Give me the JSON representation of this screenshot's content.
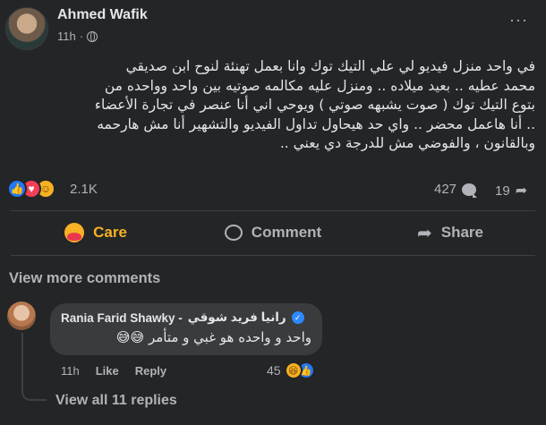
{
  "post": {
    "author": "Ahmed Wafik",
    "time": "11h",
    "more_label": "···",
    "text_lines": [
      "في واحد منزل فيديو لي علي التيك توك وانا بعمل تهنئة لنوح ابن صديقي",
      "محمد عطيه .. بعيد ميلاده .. ومنزل عليه مكالمه صوتيه بين واحد وواحده من",
      "بتوع التيك توك ( صوت يشبهه صوتي ) ويوحي اني أنا عنصر في تجارة الأعضاء",
      ".. أنا هاعمل محضر .. واي حد هيحاول تداول الفيديو والتشهير أنا مش هارحمه",
      "وبالقانون ، والفوضي مش للدرجة دي يعني .."
    ]
  },
  "stats": {
    "reactions": "2.1K",
    "comments": "427",
    "shares": "19"
  },
  "actions": {
    "care": "Care",
    "comment": "Comment",
    "share": "Share"
  },
  "comments": {
    "view_more": "View more comments",
    "items": [
      {
        "author_ar": "رانيا فريد شوقي",
        "author_en": "Rania Farid Shawky -",
        "text": "واحد و واحده هو غبي و متأمر 😅😅",
        "time": "11h",
        "like_label": "Like",
        "reply_label": "Reply",
        "reaction_count": "45"
      }
    ],
    "view_all_replies": "View all 11 replies"
  },
  "colors": {
    "background": "#242526",
    "bubble": "#3a3b3c",
    "like_blue": "#2078f4",
    "love_red": "#f33e58",
    "care_yellow": "#f7b125",
    "secondary_text": "#b0b3b8"
  }
}
